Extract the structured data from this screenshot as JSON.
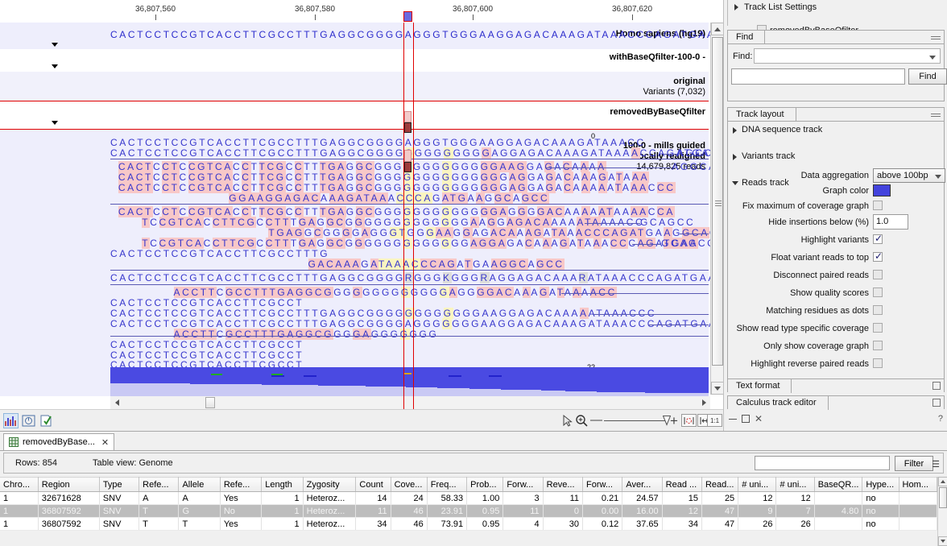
{
  "ruler": {
    "labels": [
      "36,807,560",
      "36,807,580",
      "36,807,600",
      "36,807,620"
    ]
  },
  "tracks": [
    {
      "name": "reference",
      "label": "Homo sapiens (hg19)",
      "sequence": "CACTCCTCCGTCACCTTCGCCTTTGAGGCGGGGAGGGTGGGAAGGAGACAAAGATAAACCCAGATGAAGGCAGCC"
    },
    {
      "name": "variants-withbaseqfilter",
      "label": "withBaseQfilter-100-0 -",
      "sequence": ""
    },
    {
      "name": "variants-original",
      "label": "original",
      "sublabel": "Variants (7,032)",
      "sequence": ""
    },
    {
      "name": "variants-removedbybaseqfilter",
      "label": "removedByBaseQfilter",
      "sequence": ""
    },
    {
      "name": "reads",
      "label": "100-0 - mills guided",
      "label2": "locally realigned",
      "label3": "14,679,825 reads",
      "axis_top": "0",
      "axis_bottom": "22"
    }
  ],
  "reads": [
    {
      "start": 0,
      "seq": "CACTCCTCCGTCACCTTCGCCTTTGAGGCGGGGAGGGTGGGAAGGAGACAAAGATAAACC",
      "tail": 0
    },
    {
      "start": 0,
      "seq": "CACTCCTCCGTCACCTTCGCCTTTGAGGCGGGGGGGGGGGGGAGGAGACAAAGATAAAACCAGATGAAGG",
      "tail": 5,
      "tailseq": "AGCC"
    },
    {
      "start": 1,
      "seq": "CACTCCTCCGTCACCTTCGCCTTTGAGGCGGGGGGGGGGGGGAAGGAGACAAAA",
      "gapto": 71,
      "tailseq": "AGGCAGCC"
    },
    {
      "start": 1,
      "seq": "CACTCCTCCGTCACCTTCGCCTTTGAGGCGGGGGGGGGGGGGGAGGAGACAAAGATAAA",
      "gapto": 75,
      "tailseq": ""
    },
    {
      "start": 1,
      "seq": "CACTCCTCCGTCACCTTCGCCTTTGAGGCGGGGGGGGGGGGGGAGGAGACAAAAATAAACCC",
      "gapto": 75,
      "tailseq": ""
    },
    {
      "start": 15,
      "seq": "GGAAGGAGACAAAGATAAACCCAGATGAAGGCAGCC",
      "tail": 0
    },
    {
      "start": 1,
      "seq": "CACTCCTCCGTCACCTTCGCCTTTGAGGCGGGGGGGGGGGGGAGGGGACAAAAATAAAACCA",
      "gapto": 75
    },
    {
      "start": 4,
      "seq": "TCCGTCACCTTCGCCTTTGAGGCGGGGGGGGGGGGGAAGGAGACAAAAATAAAACC",
      "gapto": 67,
      "tailseq": "GCAGCC"
    },
    {
      "start": 20,
      "seq": "TGAGGCGGGGAGGGTGGGAAGGAGACAAAGATAAACCCAGATGAAGGCAGCC"
    },
    {
      "start": 4,
      "seq": "TCCGTCACCTTCGCCTTTGAGGCGGGGGGGGGGGGGAGGAGACAAAGATAAACCCAGATGAA",
      "tailseq": "GCAGCC"
    },
    {
      "start": 0,
      "seq": "CACTCCTCCGTCACCTTCGCCTTTG"
    },
    {
      "start": 25,
      "seq": "GACAAAGATAAACCCAGATGAAGGCAGCC"
    },
    {
      "start": 0,
      "seq": "CACTCCTCCGTCACCTTCGCCTTTGAGGCGGGGRGGGKGGGRAGGAGACAAARATAAACCCAGATGAAGGCAGCC"
    },
    {
      "start": 8,
      "seq": "ACCTTCGCCTTTGAGGCGGGGGGGGGGGGGAGGGGACAAAGATAAAACC"
    },
    {
      "start": 0,
      "seq": "CACTCCTCCGTCACCTTCGCCT"
    },
    {
      "start": 0,
      "seq": "CACTCCTCCGTCACCTTCGCCTTTGAGGCGGGGGGGGGGGGAAGGAGACAAAAATAAACCC"
    },
    {
      "start": 0,
      "seq": "CACTCCTCCGTCACCTTCGCCTTTGAGGCGGGGAGGGGGGGAAGGAGACAAAGATAAACCCAGATGAA"
    },
    {
      "start": 8,
      "seq": "ACCTTCGCCTTTGAGGCGGGGAGGGGGGG"
    },
    {
      "start": 0,
      "seq": "CACTCCTCCGTCACCTTCGCCT"
    },
    {
      "start": 0,
      "seq": "CACTCCTCCGTCACCTTCGCCT"
    },
    {
      "start": 0,
      "seq": "CACTCCTCCGTCACCTTCGCCT"
    },
    {
      "start": 62,
      "seq": "TGAAGGCAGCC",
      "reverse": true
    }
  ],
  "sidepanel": {
    "track_list_settings": {
      "title": "Track List Settings",
      "child_label": "removedByBaseQfilter",
      "child_checked": false
    },
    "find": {
      "tab_label": "Find",
      "field_label": "Find:",
      "combo_value": "",
      "input_value": "",
      "button_label": "Find"
    },
    "track_layout": {
      "tab_label": "Track layout",
      "items": [
        {
          "label": "DNA sequence track",
          "expanded": false
        },
        {
          "label": "Variants track",
          "expanded": false
        },
        {
          "label": "Reads track",
          "expanded": true
        }
      ],
      "reads_track": {
        "data_aggregation_label": "Data aggregation",
        "data_aggregation_value": "above 100bp",
        "graph_color_label": "Graph color",
        "graph_color_value": "#4343dd",
        "options": [
          {
            "label": "Fix maximum of coverage graph",
            "checked": false
          },
          {
            "label": "Highlight variants",
            "checked": true
          },
          {
            "label": "Float variant reads to top",
            "checked": true
          },
          {
            "label": "Disconnect paired reads",
            "checked": false
          },
          {
            "label": "Show quality scores",
            "checked": false
          },
          {
            "label": "Matching residues as dots",
            "checked": false
          },
          {
            "label": "Show read type specific coverage",
            "checked": false
          },
          {
            "label": "Only show coverage graph",
            "checked": false
          },
          {
            "label": "Highlight reverse paired reads",
            "checked": false
          }
        ],
        "hide_insertions_label": "Hide insertions below (%)",
        "hide_insertions_value": "1.0"
      }
    },
    "text_format": {
      "tab_label": "Text format"
    },
    "calculus_track_editor": {
      "tab_label": "Calculus track editor"
    }
  },
  "bottom": {
    "tab_label": "removedByBase...",
    "tab_icon": "table-icon",
    "rows_label": "Rows: 854",
    "table_view_label": "Table view: Genome",
    "filter_value": "",
    "filter_button": "Filter",
    "columns": [
      "Chro...",
      "Region",
      "Type",
      "Refe...",
      "Allele",
      "Refe...",
      "Length",
      "Zygosity",
      "Count",
      "Cove...",
      "Freq...",
      "Prob...",
      "Forw...",
      "Reve...",
      "Forw...",
      "Aver...",
      "Read ...",
      "Read...",
      "# uni...",
      "# uni...",
      "BaseQR...",
      "Hype...",
      "Hom..."
    ],
    "rows": [
      {
        "selected": false,
        "cells": [
          "1",
          "32671628",
          "SNV",
          "A",
          "A",
          "Yes",
          "1",
          "Heteroz...",
          "14",
          "24",
          "58.33",
          "1.00",
          "3",
          "11",
          "0.21",
          "24.57",
          "15",
          "25",
          "12",
          "12",
          "",
          "no",
          ""
        ]
      },
      {
        "selected": true,
        "cells": [
          "1",
          "36807592",
          "SNV",
          "T",
          "G",
          "No",
          "1",
          "Heteroz...",
          "11",
          "46",
          "23.91",
          "0.95",
          "11",
          "0",
          "0.00",
          "16.00",
          "12",
          "47",
          "9",
          "7",
          "4.80",
          "no",
          ""
        ]
      },
      {
        "selected": false,
        "cells": [
          "1",
          "36807592",
          "SNV",
          "T",
          "T",
          "Yes",
          "1",
          "Heteroz...",
          "34",
          "46",
          "73.91",
          "0.95",
          "4",
          "30",
          "0.12",
          "37.65",
          "34",
          "47",
          "26",
          "26",
          "",
          "no",
          ""
        ]
      }
    ]
  },
  "toolbar": {
    "icons": [
      "coverage-chart-icon",
      "circle-icon",
      "checklist-icon"
    ],
    "selection_tool": "pointer-icon",
    "zoom_tool": "zoom-icon",
    "zoom_out": "minus-icon",
    "zoom_in": "plus-icon",
    "fit_selection": "fit-selection-icon",
    "fit_width": "fit-width-icon",
    "one_to_one": "1:1"
  }
}
